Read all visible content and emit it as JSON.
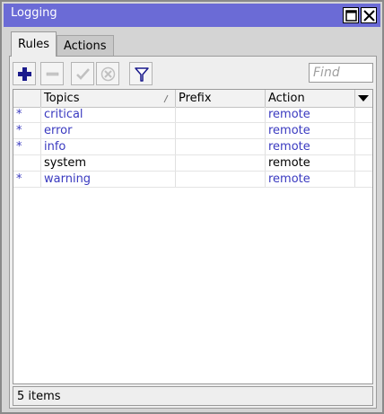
{
  "window": {
    "title": "Logging"
  },
  "tabs": [
    {
      "label": "Rules",
      "active": true
    },
    {
      "label": "Actions",
      "active": false
    }
  ],
  "toolbar": {
    "add_icon": "plus-icon",
    "remove_icon": "minus-icon",
    "enable_icon": "check-icon",
    "disable_icon": "x-icon",
    "filter_icon": "filter-icon",
    "find_placeholder": "Find"
  },
  "table": {
    "columns": [
      {
        "key": "flag",
        "label": ""
      },
      {
        "key": "topics",
        "label": "Topics"
      },
      {
        "key": "prefix",
        "label": "Prefix"
      },
      {
        "key": "action",
        "label": "Action"
      }
    ],
    "rows": [
      {
        "flag": "*",
        "topics": "critical",
        "prefix": "",
        "action": "remote",
        "dynamic": true
      },
      {
        "flag": "*",
        "topics": "error",
        "prefix": "",
        "action": "remote",
        "dynamic": true
      },
      {
        "flag": "*",
        "topics": "info",
        "prefix": "",
        "action": "remote",
        "dynamic": true
      },
      {
        "flag": "",
        "topics": "system",
        "prefix": "",
        "action": "remote",
        "dynamic": false
      },
      {
        "flag": "*",
        "topics": "warning",
        "prefix": "",
        "action": "remote",
        "dynamic": true
      }
    ]
  },
  "status": {
    "text": "5 items"
  },
  "colors": {
    "titlebar": "#6b6bd6",
    "dynamic_text": "#3a3ac0",
    "accent_icon": "#1a1a8c"
  }
}
